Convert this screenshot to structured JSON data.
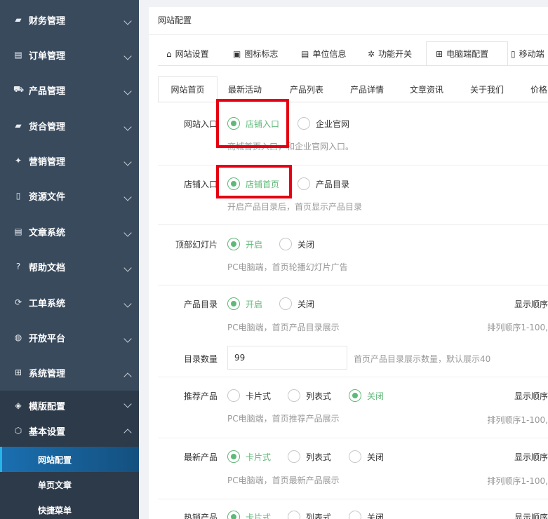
{
  "sidebar": {
    "items": [
      {
        "label": "财务管理",
        "icon": "finance-icon"
      },
      {
        "label": "订单管理",
        "icon": "order-icon"
      },
      {
        "label": "产品管理",
        "icon": "cart-icon"
      },
      {
        "label": "货合管理",
        "icon": "warehouse-icon"
      },
      {
        "label": "营销管理",
        "icon": "marketing-icon"
      },
      {
        "label": "资源文件",
        "icon": "file-icon"
      },
      {
        "label": "文章系统",
        "icon": "article-icon"
      },
      {
        "label": "帮助文档",
        "icon": "help-icon"
      },
      {
        "label": "工单系统",
        "icon": "ticket-icon"
      },
      {
        "label": "开放平台",
        "icon": "globe-icon"
      },
      {
        "label": "系统管理",
        "icon": "windows-icon"
      }
    ],
    "sub_items": [
      {
        "label": "模版配置",
        "icon": "layers-icon"
      },
      {
        "label": "基本设置",
        "icon": "cube-icon"
      }
    ],
    "leaves": [
      "网站配置",
      "单页文章",
      "快捷菜单"
    ]
  },
  "breadcrumb": "网站配置",
  "tabs_primary": [
    {
      "label": "网站设置",
      "icon": "⌂"
    },
    {
      "label": "图标标志",
      "icon": "▣"
    },
    {
      "label": "单位信息",
      "icon": "▤"
    },
    {
      "label": "功能开关",
      "icon": "✲"
    },
    {
      "label": "电脑端配置",
      "icon": "⊞"
    },
    {
      "label": "移动端",
      "icon": "▯"
    }
  ],
  "tabs_secondary": [
    "网站首页",
    "最新活动",
    "产品列表",
    "产品详情",
    "文章资讯",
    "关于我们",
    "价格"
  ],
  "form": {
    "site_entry": {
      "label": "网站入口",
      "opt1": "店铺入口",
      "opt2": "企业官网",
      "hint": "商城首页入口，和企业官网入口。"
    },
    "shop_entry": {
      "label": "店铺入口",
      "opt1": "店铺首页",
      "opt2": "产品目录",
      "hint": "开启产品目录后，首页显示产品目录"
    },
    "slideshow": {
      "label": "顶部幻灯片",
      "opt1": "开启",
      "opt2": "关闭",
      "hint": "PC电脑端，首页轮播幻灯片广告"
    },
    "catalog": {
      "label": "产品目录",
      "opt1": "开启",
      "opt2": "关闭",
      "hint": "PC电脑端，首页产品目录展示",
      "order_label": "显示顺序",
      "order_hint": "排列顺序1-100,"
    },
    "catalog_count": {
      "label": "目录数量",
      "value": "99",
      "hint": "首页产品目录展示数量，默认展示40"
    },
    "recommended": {
      "label": "推荐产品",
      "opt1": "卡片式",
      "opt2": "列表式",
      "opt3": "关闭",
      "hint": "PC电脑端，首页推荐产品展示",
      "order_label": "显示顺序",
      "order_hint": "排列顺序1-100,"
    },
    "latest": {
      "label": "最新产品",
      "opt1": "卡片式",
      "opt2": "列表式",
      "opt3": "关闭",
      "hint": "PC电脑端，首页最新产品展示",
      "order_label": "显示顺序",
      "order_hint": "排列顺序1-100,"
    },
    "hot": {
      "label": "热销产品",
      "opt1": "卡片式",
      "opt2": "列表式",
      "opt3": "关闭",
      "order_label": "显示顺序"
    }
  },
  "colors": {
    "accent": "#5fb878",
    "sidebar_bg": "#394a5d",
    "highlight": "#e60012",
    "active_item": "#1a6fb0"
  }
}
